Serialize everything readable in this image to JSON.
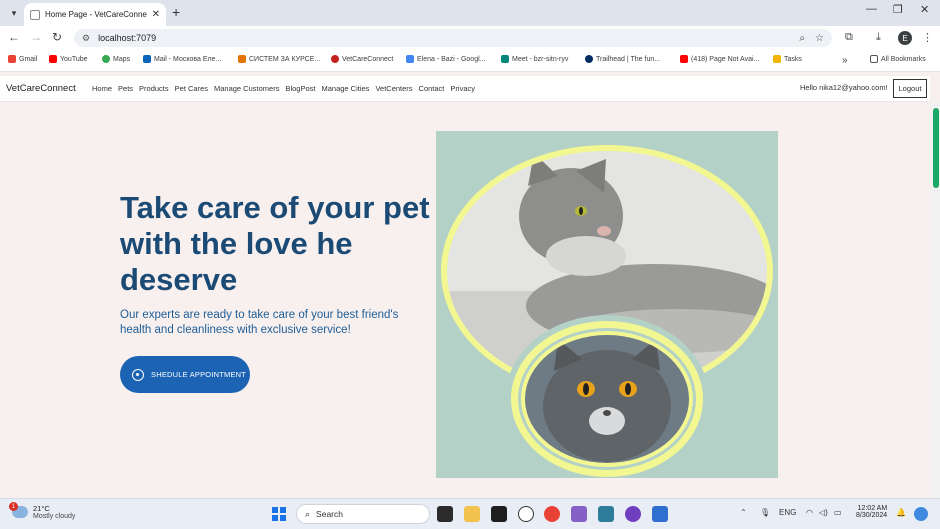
{
  "browser": {
    "tab_title": "Home Page - VetCareConnect",
    "url": "localhost:7079",
    "bookmarks": [
      "Gmail",
      "YouTube",
      "Maps",
      "Mail - Москова Еле...",
      "СИСТЕМ ЗА КУРСЕ...",
      "VetCareConnect",
      "Elena - Bazi - Googl...",
      "Meet - bzr-sitn-ryv",
      "Trailhead | The fun...",
      "(418) Page Not Avai...",
      "Tasks"
    ],
    "all_bookmarks": "All Bookmarks",
    "profile_initial": "E"
  },
  "site": {
    "brand": "VetCareConnect",
    "nav": [
      "Home",
      "Pets",
      "Products",
      "Pet Cares",
      "Manage Customers",
      "BlogPost",
      "Manage Cities",
      "VetCenters",
      "Contact",
      "Privacy"
    ],
    "hello": "Hello nika12@yahoo.com!",
    "logout": "Logout"
  },
  "hero": {
    "title": "Take care of your pet with the love he deserve",
    "subtitle": "Our experts are ready to take care of your best friend's health and cleanliness with exclusive service!",
    "cta": "SHEDULE APPOINTMENT"
  },
  "taskbar": {
    "weather_badge": "1",
    "temperature": "21°C",
    "condition": "Mostly cloudy",
    "search": "Search",
    "lang": "ENG",
    "time": "12:02 AM",
    "date": "8/30/2024"
  },
  "colors": {
    "hero_title": "#1b4a75",
    "cta_bg": "#1c63b4",
    "image_bg": "#b3d1c6",
    "ring": "#f3f791",
    "page_bg": "#f7f0ef"
  }
}
